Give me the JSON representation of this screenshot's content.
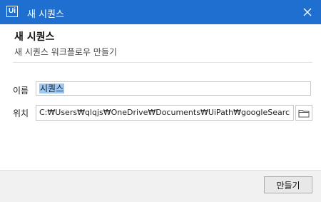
{
  "window": {
    "logo_text": "Ui",
    "title": "새 시퀀스"
  },
  "dialog": {
    "heading": "새 시퀀스",
    "subtitle": "새 시퀀스 워크플로우 만들기"
  },
  "form": {
    "name_label": "이름",
    "name_value": "시퀀스",
    "location_label": "위치",
    "location_value": "C:₩Users₩qlqjs₩OneDrive₩Documents₩UiPath₩googleSearc"
  },
  "footer": {
    "create_label": "만들기"
  },
  "icons": {
    "close": "close-icon",
    "folder": "folder-icon"
  },
  "colors": {
    "titlebar": "#1f6fd0",
    "selection": "#9ec9f5"
  }
}
